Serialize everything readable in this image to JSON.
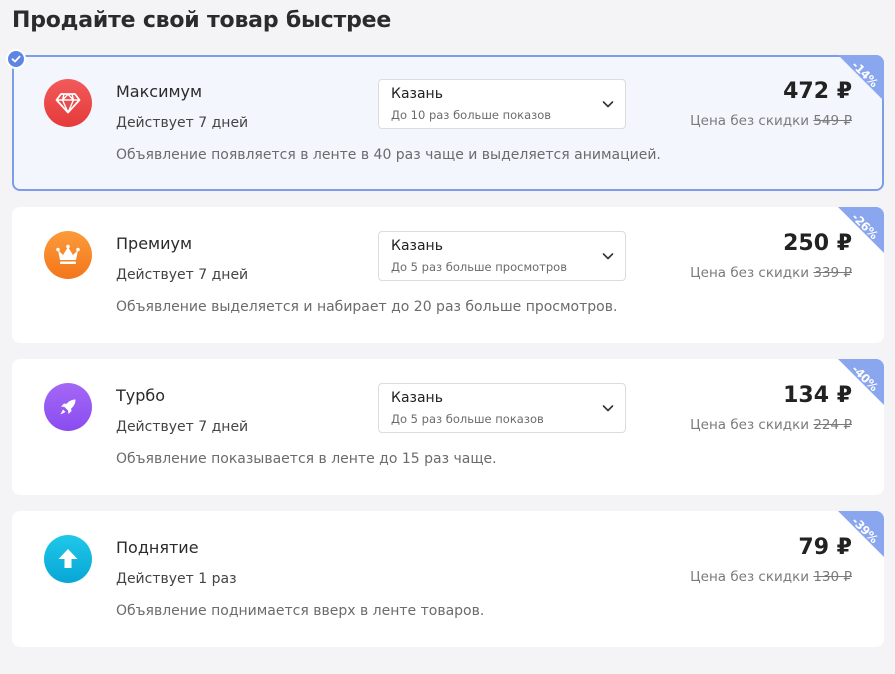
{
  "page": {
    "title": "Продайте свой товар быстрее"
  },
  "colors": {
    "accent": "#5c85e6",
    "ribbon": "#8aa6ef"
  },
  "cards": [
    {
      "name": "Максимум",
      "duration": "Действует 7 дней",
      "description": "Объявление появляется в ленте в 40 раз чаще и выделяется анимацией.",
      "select_value": "Казань",
      "select_hint": "До 10 раз больше показов",
      "price": "472 ₽",
      "old_price_label": "Цена без скидки",
      "old_price": "549 ₽",
      "discount": "-14%",
      "icon": "diamond-icon",
      "selected": true
    },
    {
      "name": "Премиум",
      "duration": "Действует 7 дней",
      "description": "Объявление выделяется и набирает до 20 раз больше просмотров.",
      "select_value": "Казань",
      "select_hint": "До 5 раз больше просмотров",
      "price": "250 ₽",
      "old_price_label": "Цена без скидки",
      "old_price": "339 ₽",
      "discount": "-26%",
      "icon": "crown-icon",
      "selected": false
    },
    {
      "name": "Турбо",
      "duration": "Действует 7 дней",
      "description": "Объявление показывается в ленте до 15 раз чаще.",
      "select_value": "Казань",
      "select_hint": "До 5 раз больше показов",
      "price": "134 ₽",
      "old_price_label": "Цена без скидки",
      "old_price": "224 ₽",
      "discount": "-40%",
      "icon": "rocket-icon",
      "selected": false
    },
    {
      "name": "Поднятие",
      "duration": "Действует 1 раз",
      "description": "Объявление поднимается вверх в ленте товаров.",
      "price": "79 ₽",
      "old_price_label": "Цена без скидки",
      "old_price": "130 ₽",
      "discount": "-39%",
      "icon": "arrow-up-icon",
      "selected": false
    }
  ]
}
